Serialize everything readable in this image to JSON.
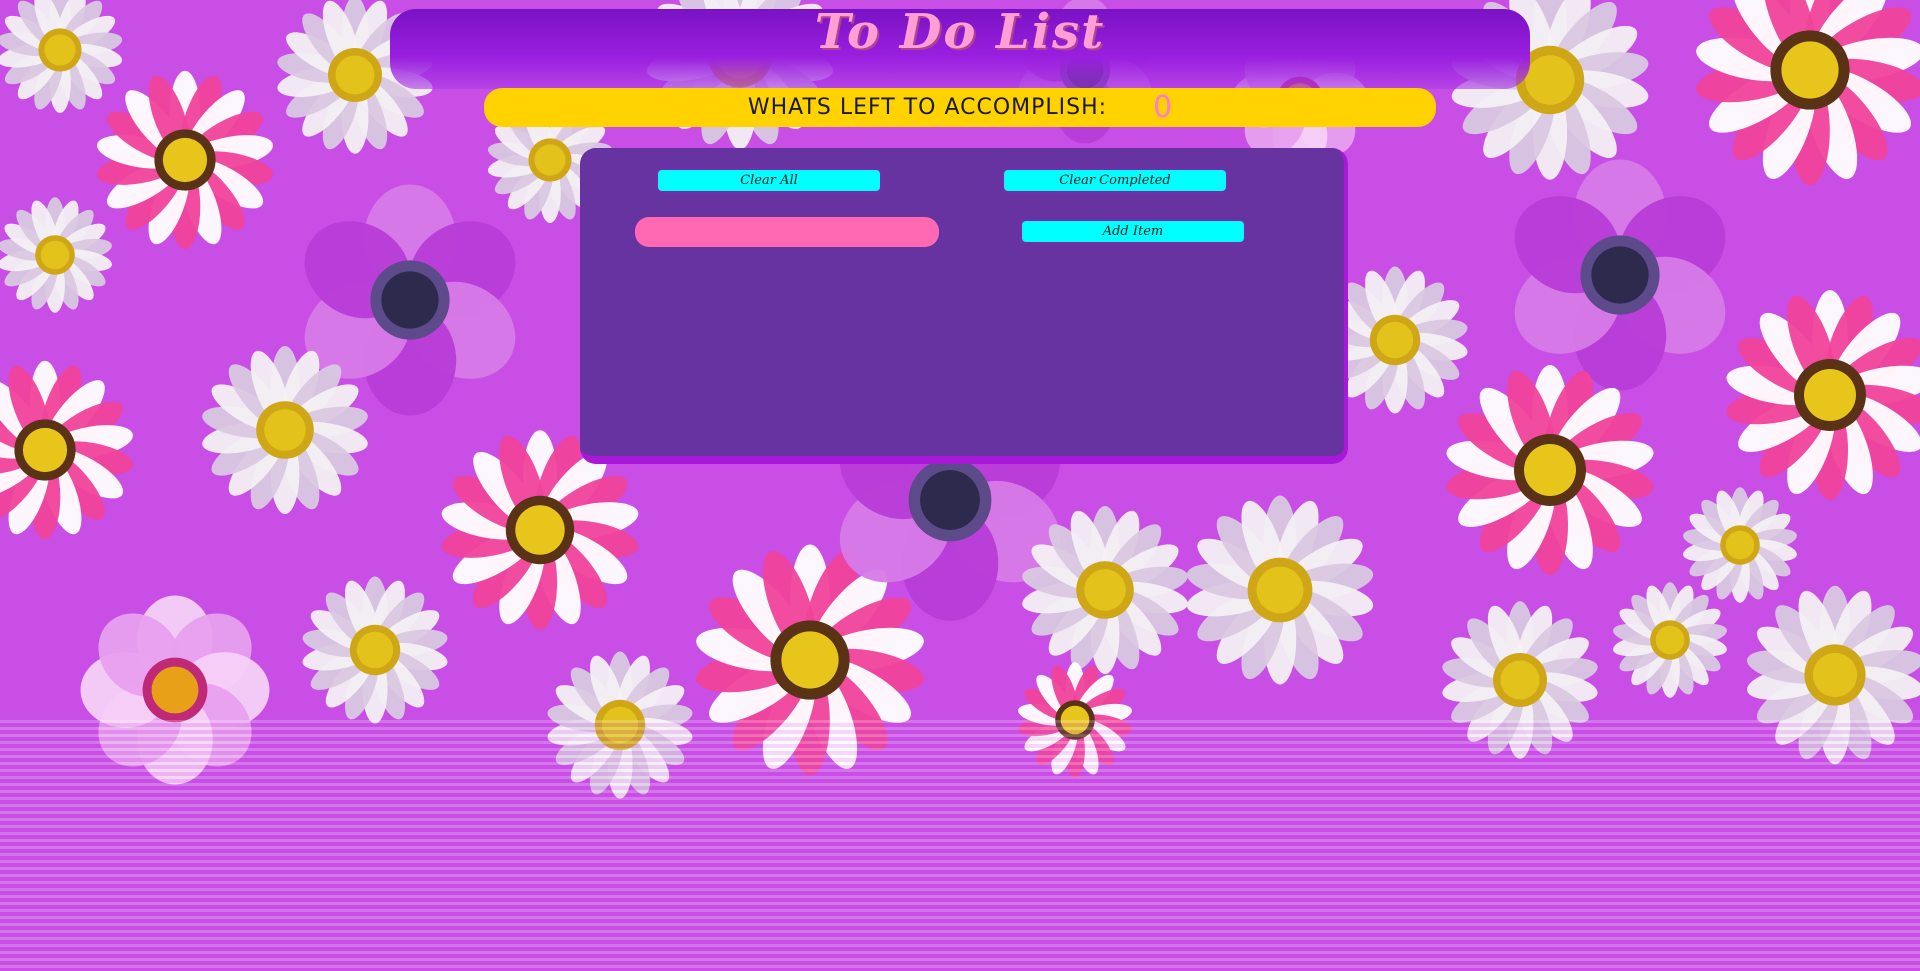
{
  "app": {
    "title": "To Do List"
  },
  "counter": {
    "label": "whats left to accomplish:",
    "value": "0"
  },
  "controls": {
    "clear_all_label": "Clear All",
    "clear_completed_label": "Clear Completed",
    "add_item_label": "Add Item",
    "new_item_input": {
      "value": "",
      "placeholder": ""
    }
  },
  "todo_items": [],
  "colors": {
    "background": "#c94ee6",
    "header": "#7a12c4",
    "counter_bar": "#ffd200",
    "panel": "#6633a0",
    "buttons": "#00ffff",
    "input": "#ff69b4",
    "title_text": "#ff9fd6"
  }
}
